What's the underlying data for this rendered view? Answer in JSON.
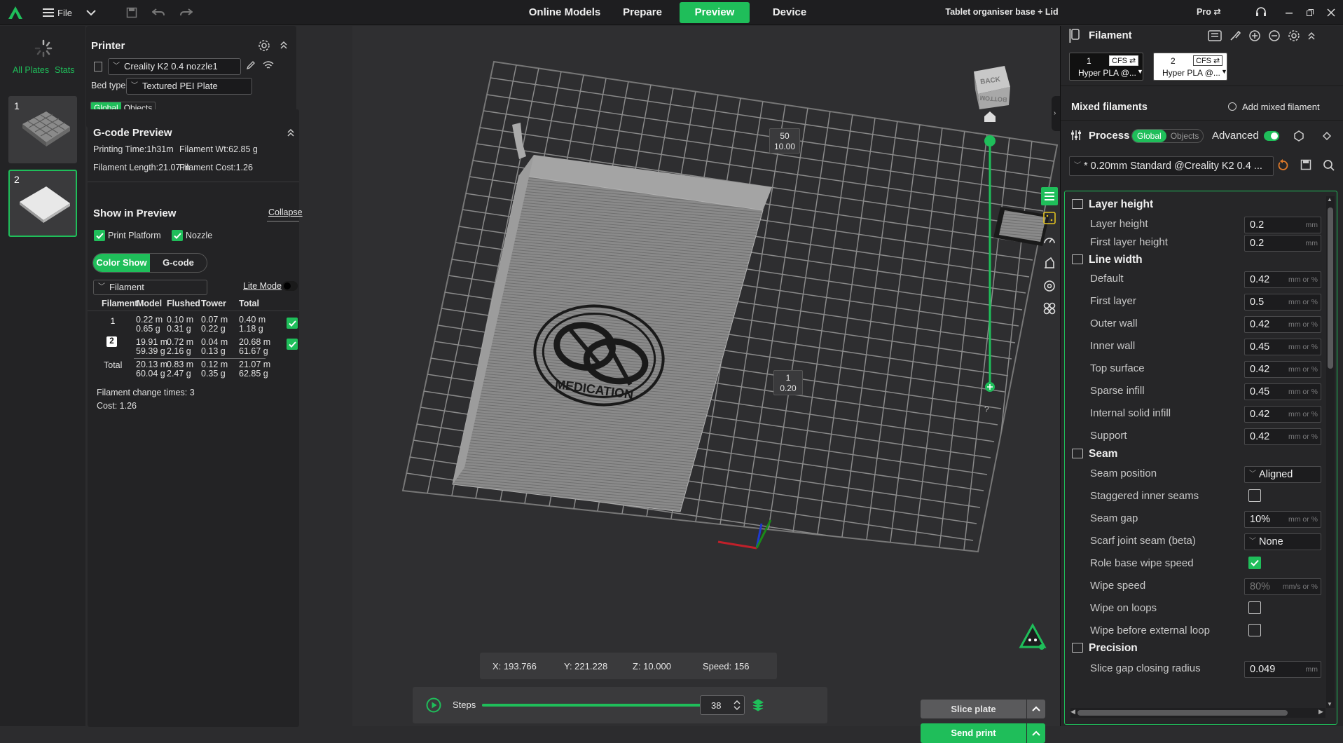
{
  "topbar": {
    "file_label": "File",
    "tabs": [
      "Online Models",
      "Prepare",
      "Preview",
      "Device"
    ],
    "active_tab": "Preview",
    "project_title": "Tablet organiser base + Lid",
    "pro_label": "Pro"
  },
  "plates": {
    "all_plates": "All Plates",
    "stats": "Stats",
    "items": [
      {
        "num": "1"
      },
      {
        "num": "2"
      }
    ]
  },
  "printer": {
    "title": "Printer",
    "printer_name": "Creality K2 0.4 nozzle1",
    "bed_type_label": "Bed type",
    "bed_type_value": "Textured PEI Plate",
    "scope": [
      "Global",
      "Objects"
    ]
  },
  "gcode_preview": {
    "title": "G-code Preview",
    "printing_time": "Printing Time:1h31m",
    "filament_weight": "Filament Wt:62.85 g",
    "filament_length": "Filament Length:21.07 m",
    "filament_cost": "Filament Cost:1.26"
  },
  "show_in_preview": {
    "title": "Show in Preview",
    "collapse": "Collapse",
    "print_platform": "Print Platform",
    "nozzle": "Nozzle",
    "color_show": "Color Show",
    "gcode": "G-code",
    "filament_dropdown": "Filament",
    "lite_mode": "Lite Mode"
  },
  "filament_table": {
    "headers": [
      "Filament",
      "Model",
      "Flushed",
      "Tower",
      "Total"
    ],
    "rows": [
      {
        "id": "1",
        "model": [
          "0.22 m",
          "0.65 g"
        ],
        "flushed": [
          "0.10 m",
          "0.31 g"
        ],
        "tower": [
          "0.07 m",
          "0.22 g"
        ],
        "total": [
          "0.40 m",
          "1.18 g"
        ]
      },
      {
        "id": "2",
        "model": [
          "19.91 m",
          "59.39 g"
        ],
        "flushed": [
          "0.72 m",
          "2.16 g"
        ],
        "tower": [
          "0.04 m",
          "0.13 g"
        ],
        "total": [
          "20.68 m",
          "61.67 g"
        ]
      }
    ],
    "total_row": {
      "label": "Total",
      "model": [
        "20.13 m",
        "60.04 g"
      ],
      "flushed": [
        "0.83 m",
        "2.47 g"
      ],
      "tower": [
        "0.12 m",
        "0.35 g"
      ],
      "total": [
        "21.07 m",
        "62.85 g"
      ]
    },
    "change_times": "Filament change times:  3",
    "cost": "Cost:  1.26"
  },
  "viewport": {
    "cube_top": "BACK",
    "cube_front": "BOTTOM",
    "layer_top": [
      "50",
      "10.00"
    ],
    "layer_bottom": [
      "1",
      "0.20"
    ],
    "help": "?",
    "coords": {
      "x": "X: 193.766",
      "y": "Y: 221.228",
      "z": "Z: 10.000",
      "speed": "Speed: 156"
    },
    "steps_label": "Steps",
    "steps_value": "38",
    "slider_fraction": 0.98,
    "emblem_text": "MEDICATION",
    "slice_plate": "Slice plate",
    "send_print": "Send print"
  },
  "filament_panel": {
    "title": "Filament",
    "slots": [
      {
        "num": "1",
        "tag": "CFS ⇄",
        "name": "Hyper PLA @...",
        "color": "#111111"
      },
      {
        "num": "2",
        "tag": "CFS ⇄",
        "name": "Hyper PLA @...",
        "color": "#ffffff"
      }
    ],
    "mixed_filaments": "Mixed filaments",
    "add_mixed": "Add mixed filament"
  },
  "process": {
    "title": "Process",
    "scope": [
      "Global",
      "Objects"
    ],
    "advanced": "Advanced",
    "profile": "* 0.20mm Standard @Creality K2 0.4 ..."
  },
  "settings": {
    "layer_height_section": "Layer height",
    "layer_height": {
      "label": "Layer height",
      "value": "0.2",
      "unit": "mm"
    },
    "first_layer_height": {
      "label": "First layer height",
      "value": "0.2",
      "unit": "mm"
    },
    "line_width_section": "Line width",
    "line_widths": [
      {
        "label": "Default",
        "value": "0.42"
      },
      {
        "label": "First layer",
        "value": "0.5"
      },
      {
        "label": "Outer wall",
        "value": "0.42"
      },
      {
        "label": "Inner wall",
        "value": "0.45"
      },
      {
        "label": "Top surface",
        "value": "0.42"
      },
      {
        "label": "Sparse infill",
        "value": "0.45"
      },
      {
        "label": "Internal solid infill",
        "value": "0.42"
      },
      {
        "label": "Support",
        "value": "0.42"
      }
    ],
    "line_width_unit": "mm or %",
    "seam_section": "Seam",
    "seam_position": {
      "label": "Seam position",
      "value": "Aligned"
    },
    "staggered": {
      "label": "Staggered inner seams"
    },
    "seam_gap": {
      "label": "Seam gap",
      "value": "10%",
      "unit": "mm or %"
    },
    "scarf": {
      "label": "Scarf joint seam (beta)",
      "value": "None"
    },
    "role_wipe": {
      "label": "Role base wipe speed"
    },
    "wipe_speed": {
      "label": "Wipe speed",
      "value": "80%",
      "unit": "mm/s or %"
    },
    "wipe_loops": {
      "label": "Wipe on loops"
    },
    "wipe_before": {
      "label": "Wipe before external loop"
    },
    "precision_section": "Precision",
    "slice_gap": {
      "label": "Slice gap closing radius",
      "value": "0.049",
      "unit": "mm"
    }
  }
}
